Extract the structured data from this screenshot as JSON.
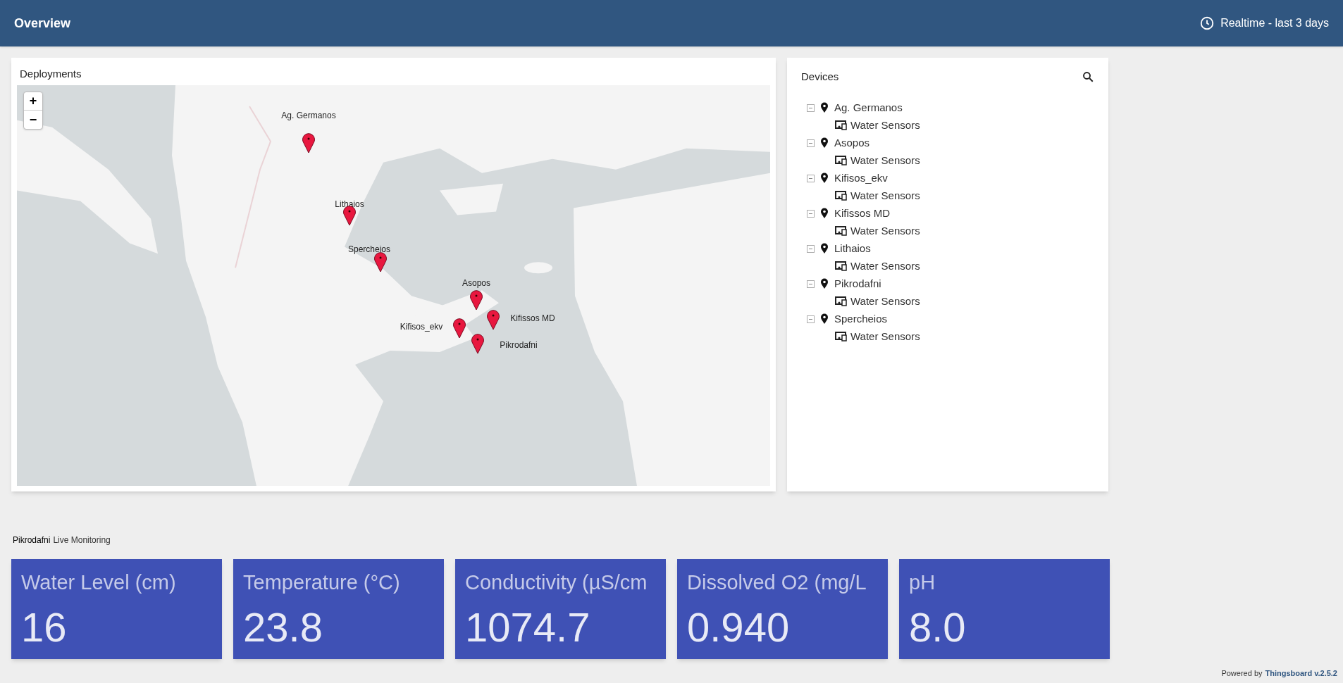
{
  "header": {
    "title": "Overview",
    "timewindow": "Realtime - last 3 days"
  },
  "deployments": {
    "title": "Deployments",
    "zoom_in": "+",
    "zoom_out": "−",
    "markers": [
      {
        "label": "Ag. Germanos"
      },
      {
        "label": "Lithaios"
      },
      {
        "label": "Spercheios"
      },
      {
        "label": "Asopos"
      },
      {
        "label": "Kifissos MD"
      },
      {
        "label": "Kifisos_ekv"
      },
      {
        "label": "Pikrodafni"
      }
    ]
  },
  "devices": {
    "title": "Devices",
    "tree": [
      {
        "label": "Ag. Germanos",
        "expanded": true,
        "children": [
          {
            "label": "Water Sensors"
          }
        ]
      },
      {
        "label": "Asopos",
        "expanded": true,
        "children": [
          {
            "label": "Water Sensors"
          }
        ]
      },
      {
        "label": "Kifisos_ekv",
        "expanded": true,
        "children": [
          {
            "label": "Water Sensors"
          }
        ]
      },
      {
        "label": "Kifissos MD",
        "expanded": true,
        "children": [
          {
            "label": "Water Sensors"
          }
        ]
      },
      {
        "label": "Lithaios",
        "expanded": true,
        "children": [
          {
            "label": "Water Sensors"
          }
        ]
      },
      {
        "label": "Pikrodafni",
        "expanded": true,
        "children": [
          {
            "label": "Water Sensors"
          }
        ]
      },
      {
        "label": "Spercheios",
        "expanded": true,
        "children": [
          {
            "label": "Water Sensors"
          }
        ]
      }
    ]
  },
  "monitoring": {
    "station": "Pikrodafni",
    "title": "Live Monitoring",
    "cards": [
      {
        "label": "Water Level (cm)",
        "value": "16"
      },
      {
        "label": "Temperature (°C)",
        "value": "23.8"
      },
      {
        "label": "Conductivity (µS/cm",
        "value": "1074.7"
      },
      {
        "label": "Dissolved O2 (mg/L",
        "value": "0.940"
      },
      {
        "label": "pH",
        "value": "8.0"
      }
    ]
  },
  "footer": {
    "prefix": "Powered by",
    "brand": "Thingsboard v.2.5.2"
  }
}
